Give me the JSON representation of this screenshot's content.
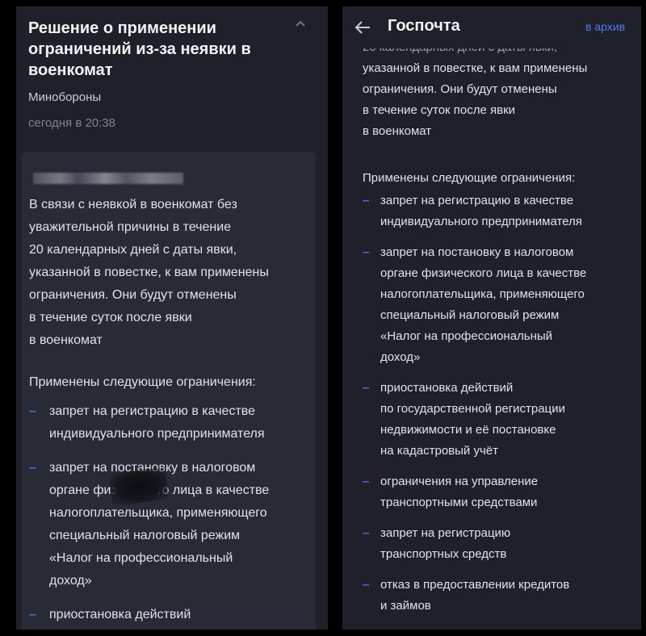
{
  "left": {
    "title_lines": [
      "Решение о применении",
      "ограничений из-за неявки в",
      "военкомат"
    ],
    "sender": "Минобороны",
    "time": "сегодня в 20:38",
    "body_lines": [
      "В связи с неявкой в военкомат без",
      "уважительной причины в течение",
      "20 календарных дней с даты явки,",
      "указанной в повестке, к вам применены",
      "ограничения. Они будут отменены",
      "в течение суток после явки",
      "в военкомат"
    ],
    "restrictions_heading": "Применены следующие ограничения:",
    "restrictions": [
      {
        "lines": [
          "запрет на регистрацию в качестве",
          "индивидуального предпринимателя"
        ]
      },
      {
        "lines": [
          "запрет на постановку в налоговом",
          "органе физического лица в качестве",
          "налогоплательщика, применяющего",
          "специальный налоговый режим",
          "«Налог на профессиональный",
          "доход»"
        ]
      },
      {
        "lines": [
          "приостановка действий"
        ]
      }
    ]
  },
  "right": {
    "back_icon": "arrow-left-icon",
    "title": "Госпочта",
    "archive_label": "в архив",
    "body_lines": [
      "указанной в повестке, к вам применены",
      "ограничения. Они будут отменены",
      "в течение суток после явки",
      "в военкомат"
    ],
    "restrictions_heading": "Применены следующие ограничения:",
    "restrictions": [
      {
        "lines": [
          "запрет на регистрацию в качестве",
          "индивидуального предпринимателя"
        ]
      },
      {
        "lines": [
          "запрет на постановку в налоговом",
          "органе физического лица в качестве",
          "налогоплательщика, применяющего",
          "специальный налоговый режим",
          "«Налог на профессиональный",
          "доход»"
        ]
      },
      {
        "lines": [
          "приостановка действий",
          "по государственной регистрации",
          "недвижимости и её постановке",
          "на кадастровый учёт"
        ]
      },
      {
        "lines": [
          "ограничения на управление",
          "транспортными средствами"
        ]
      },
      {
        "lines": [
          "запрет на регистрацию",
          "транспортных средств"
        ]
      },
      {
        "lines": [
          "отказ в предоставлении кредитов",
          "и займов"
        ]
      }
    ]
  },
  "colors": {
    "panel_bg": "#1f2029",
    "card_bg": "#282a35",
    "accent": "#3f6fe8",
    "link": "#4f7cf0"
  }
}
